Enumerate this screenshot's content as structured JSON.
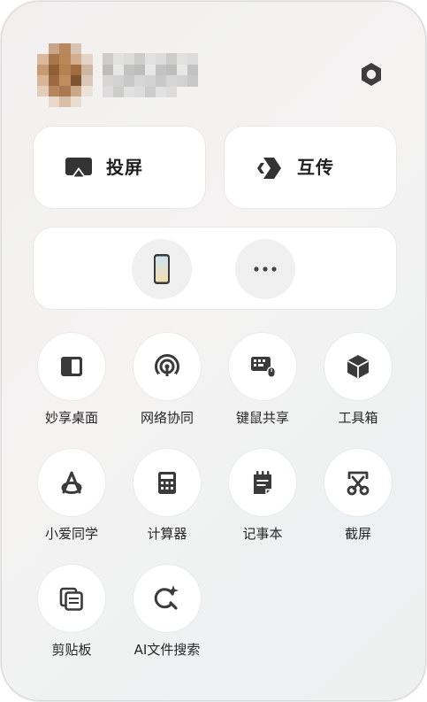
{
  "user": {
    "avatar_icon": "pixelated-avatar",
    "name_icon": "pixelated-username"
  },
  "settings": {
    "icon": "gear-icon"
  },
  "actions": {
    "cast": {
      "label": "投屏",
      "icon": "screen-cast-icon"
    },
    "transfer": {
      "label": "互传",
      "icon": "transfer-icon"
    }
  },
  "devices": {
    "phone": {
      "icon": "phone-icon"
    },
    "more": {
      "icon": "more-icon"
    }
  },
  "tiles": [
    {
      "label": "妙享桌面",
      "icon": "desktop-panel-icon"
    },
    {
      "label": "网络协同",
      "icon": "network-signal-icon"
    },
    {
      "label": "键鼠共享",
      "icon": "keyboard-mouse-icon"
    },
    {
      "label": "工具箱",
      "icon": "toolbox-cube-icon"
    },
    {
      "label": "小爱同学",
      "icon": "xiaoai-icon"
    },
    {
      "label": "计算器",
      "icon": "calculator-icon"
    },
    {
      "label": "记事本",
      "icon": "notepad-icon"
    },
    {
      "label": "截屏",
      "icon": "scissors-icon"
    },
    {
      "label": "剪贴板",
      "icon": "clipboard-icon"
    },
    {
      "label": "AI文件搜索",
      "icon": "ai-search-icon"
    }
  ],
  "colors": {
    "icon": "#3a3a3a",
    "card": "#ffffff",
    "panel": "#f2f1f0"
  }
}
